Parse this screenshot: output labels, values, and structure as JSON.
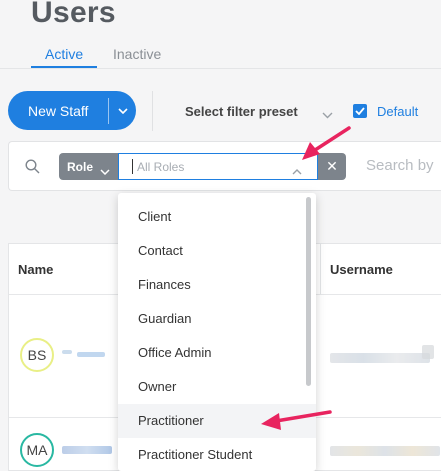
{
  "page": {
    "title": "Users"
  },
  "tabs": [
    {
      "label": "Active",
      "active": true
    },
    {
      "label": "Inactive",
      "active": false
    }
  ],
  "toolbar": {
    "new_staff_label": "New Staff",
    "filter_preset_label": "Select filter preset",
    "default_label": "Default",
    "default_checked": true
  },
  "filter": {
    "role_chip_label": "Role",
    "role_placeholder": "All Roles",
    "clear_symbol": "✕",
    "search_placeholder": "Search by"
  },
  "table": {
    "columns": [
      "Name",
      "Username"
    ],
    "rows": [
      {
        "initials": "BS",
        "avatar_color": "#e9ef86"
      },
      {
        "initials": "MA",
        "avatar_color": "#29b8a2"
      }
    ]
  },
  "dropdown": {
    "options": [
      "Client",
      "Contact",
      "Finances",
      "Guardian",
      "Office Admin",
      "Owner",
      "Practitioner",
      "Practitioner Student"
    ],
    "highlighted": "Practitioner"
  },
  "colors": {
    "accent": "#1f7fe0",
    "chip": "#7d848c",
    "annotation_arrow": "#e8245f"
  }
}
